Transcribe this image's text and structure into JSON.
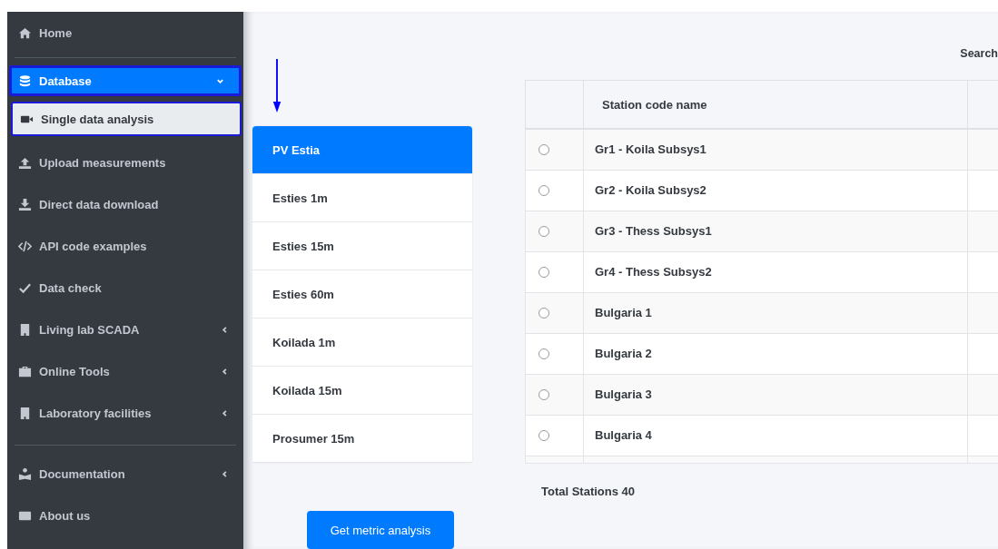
{
  "sidebar": {
    "sections": [
      [
        {
          "label": "Home",
          "kind": "item",
          "selected": false
        }
      ],
      [
        {
          "label": "Database",
          "kind": "group",
          "selected": true,
          "expanded": true
        },
        {
          "label": "Single data analysis",
          "kind": "subitem",
          "selected": true
        },
        {
          "label": "Upload measurements",
          "kind": "item",
          "selected": false
        },
        {
          "label": "Direct data download",
          "kind": "item",
          "selected": false
        },
        {
          "label": "API code examples",
          "kind": "item",
          "selected": false
        },
        {
          "label": "Data check",
          "kind": "item",
          "selected": false
        },
        {
          "label": "Living lab SCADA",
          "kind": "group",
          "selected": false,
          "expanded": false
        },
        {
          "label": "Online Tools",
          "kind": "group",
          "selected": false,
          "expanded": false
        },
        {
          "label": "Laboratory facilities",
          "kind": "group",
          "selected": false,
          "expanded": false
        }
      ],
      [
        {
          "label": "Documentation",
          "kind": "group",
          "selected": false,
          "expanded": false
        },
        {
          "label": "About us",
          "kind": "item",
          "selected": false
        }
      ]
    ]
  },
  "datasets": [
    {
      "label": "PV Estia",
      "selected": true
    },
    {
      "label": "Esties 1m",
      "selected": false
    },
    {
      "label": "Esties 15m",
      "selected": false
    },
    {
      "label": "Esties 60m",
      "selected": false
    },
    {
      "label": "Koilada 1m",
      "selected": false
    },
    {
      "label": "Koilada 15m",
      "selected": false
    },
    {
      "label": "Prosumer 15m",
      "selected": false
    }
  ],
  "action_button": "Get metric analysis",
  "search": {
    "label": "Search"
  },
  "table": {
    "columns": [
      "Station code name"
    ],
    "rows": [
      {
        "name": "Gr1 - Koila Subsys1",
        "selected": false
      },
      {
        "name": "Gr2 - Koila Subsys2",
        "selected": false
      },
      {
        "name": "Gr3 - Thess Subsys1",
        "selected": false
      },
      {
        "name": "Gr4 - Thess Subsys2",
        "selected": false
      },
      {
        "name": "Bulgaria 1",
        "selected": false
      },
      {
        "name": "Bulgaria 2",
        "selected": false
      },
      {
        "name": "Bulgaria 3",
        "selected": false
      },
      {
        "name": "Bulgaria 4",
        "selected": false
      }
    ]
  },
  "total": "Total Stations 40"
}
